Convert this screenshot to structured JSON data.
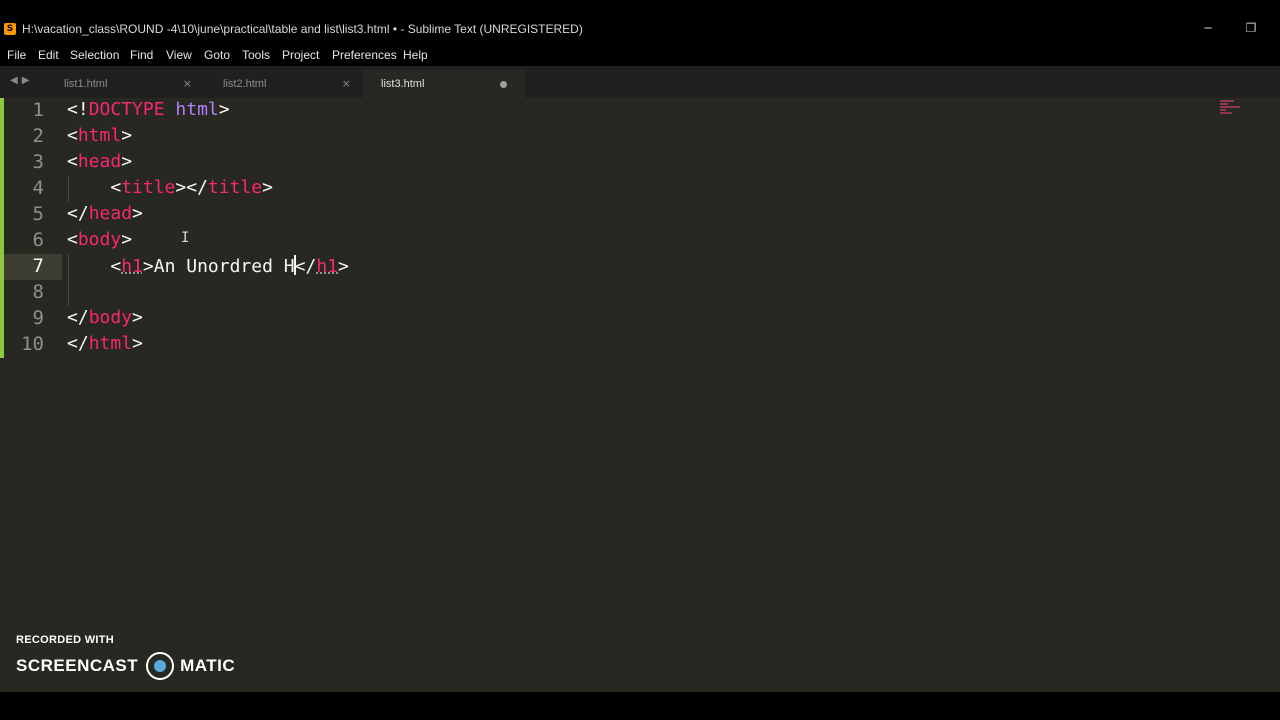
{
  "window": {
    "title": "H:\\vacation_class\\ROUND -4\\10\\june\\practical\\table and list\\list3.html • - Sublime Text (UNREGISTERED)",
    "minimize": "─",
    "restore": "❐"
  },
  "menu": [
    "File",
    "Edit",
    "Selection",
    "Find",
    "View",
    "Goto",
    "Tools",
    "Project",
    "Preferences",
    "Help"
  ],
  "nav": {
    "arrows": "◀▶"
  },
  "tabs": [
    {
      "label": "list1.html",
      "close": "×"
    },
    {
      "label": "list2.html",
      "close": "×"
    },
    {
      "label": "list3.html",
      "dirty": true
    }
  ],
  "editor": {
    "line_numbers": [
      "1",
      "2",
      "3",
      "4",
      "5",
      "6",
      "7",
      "8",
      "9",
      "10"
    ],
    "current_line": 7,
    "lines": [
      {
        "p1": "<!",
        "t1": "DOCTYPE",
        "sp": " ",
        "a1": "html",
        "p2": ">"
      },
      {
        "p1": "<",
        "t1": "html",
        "p2": ">"
      },
      {
        "p1": "<",
        "t1": "head",
        "p2": ">"
      },
      {
        "indent": "    ",
        "p1": "<",
        "t1": "title",
        "p2": "></",
        "t2": "title",
        "p3": ">"
      },
      {
        "p1": "</",
        "t1": "head",
        "p2": ">"
      },
      {
        "p1": "<",
        "t1": "body",
        "p2": ">"
      },
      {
        "indent": "    ",
        "p1": "<",
        "t1": "h1",
        "p2": ">",
        "text_before": "An Unordred H",
        "p3": "</",
        "t2": "h1",
        "p4": ">"
      },
      {},
      {
        "p1": "</",
        "t1": "body",
        "p2": ">"
      },
      {
        "p1": "</",
        "t1": "html",
        "p2": ">"
      }
    ]
  },
  "watermark": {
    "line1": "RECORDED WITH",
    "left": "SCREENCAST",
    "right": "MATIC"
  }
}
